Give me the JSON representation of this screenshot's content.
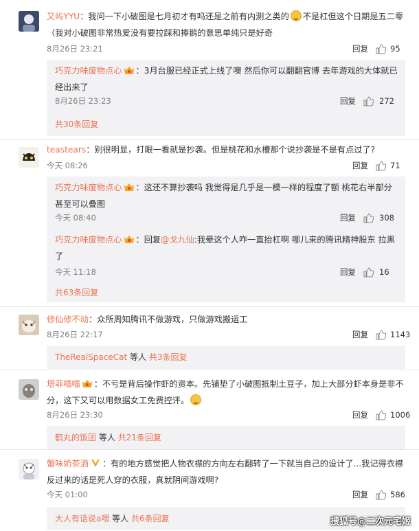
{
  "comments": [
    {
      "user": "又屿YYU",
      "sep": "：",
      "text": "我问一下小破图是七月初才有吗还是之前有内测之类的",
      "text2": "不是杠但这个日期是五二零（我对小破图非常热爱没有要拉踩和捧鹅的意思单纯只是好奇",
      "time": "8月26日 23:21",
      "reply": "回复",
      "likes": "95",
      "subs": [
        {
          "user": "巧克力味废物点心",
          "sep": "：",
          "text": "3月台服已经正式上线了噢 然后你可以翻翻官博 去年游戏的大体就已经出来了",
          "time": "8月26日 23:23",
          "reply": "回复",
          "likes": "272"
        }
      ],
      "more": "共30条回复"
    },
    {
      "user": "teastears",
      "sep": "：",
      "text": "别很明显，打眼一看就是抄袭。但是桃花和水槽那个说抄袭是不是有点过了?",
      "time": "今天 08:26",
      "reply": "回复",
      "likes": "71",
      "subs": [
        {
          "user": "巧克力味废物点心",
          "sep": "：",
          "text": "这还不算抄袭吗 我觉得是几乎是一模一样的程度了额 桃花右半部分甚至可以叠图",
          "time": "今天 08:40",
          "reply": "回复",
          "likes": "308"
        },
        {
          "user": "巧克力味废物点心",
          "sep": "：",
          "prefix": "回复",
          "mention": "@戈九仙",
          "text": ":我晕这个人咋一直抬杠啊 哪儿来的腾讯精神股东 拉黑了",
          "time": "今天 11:18",
          "reply": "回复",
          "likes": "16"
        }
      ],
      "more": "共63条回复"
    },
    {
      "user": "修仙修不动",
      "sep": "：",
      "text": "众所周知腾讯不做游戏，只做游戏搬运工",
      "time": "8月26日 22:17",
      "reply": "回复",
      "likes": "1143",
      "more_user": "TheRealSpaceCat",
      "more_plain": " 等人 ",
      "more": "共3条回复"
    },
    {
      "user": "塔菲喵喵",
      "sep": "：",
      "text": "不亏是背后操作虾的资本。先铺垫了小破图抵制土豆子，加上大部分虾本身是非不分，这下又可以用数据女工免费控评。",
      "time": "8月26日 23:30",
      "reply": "回复",
      "likes": "1006",
      "more_user": "鹤丸的饭团",
      "more_plain": " 等人 ",
      "more": "共21条回复"
    },
    {
      "user": "蟹味奶茶酒",
      "sep": "：",
      "text": "有的地方感觉把人物衣襟的方向左右翻转了一下就当自己的设计了...我记得衣襟反过来的话是死人穿的衣服，真就阴间游戏啊?",
      "time": "今天 01:00",
      "reply": "回复",
      "likes": "586",
      "more_user": "大人有话说a喂",
      "more_plain": " 等人 ",
      "more": "共6条回复"
    }
  ],
  "watermark": "搜狐号@二次元宅姬"
}
